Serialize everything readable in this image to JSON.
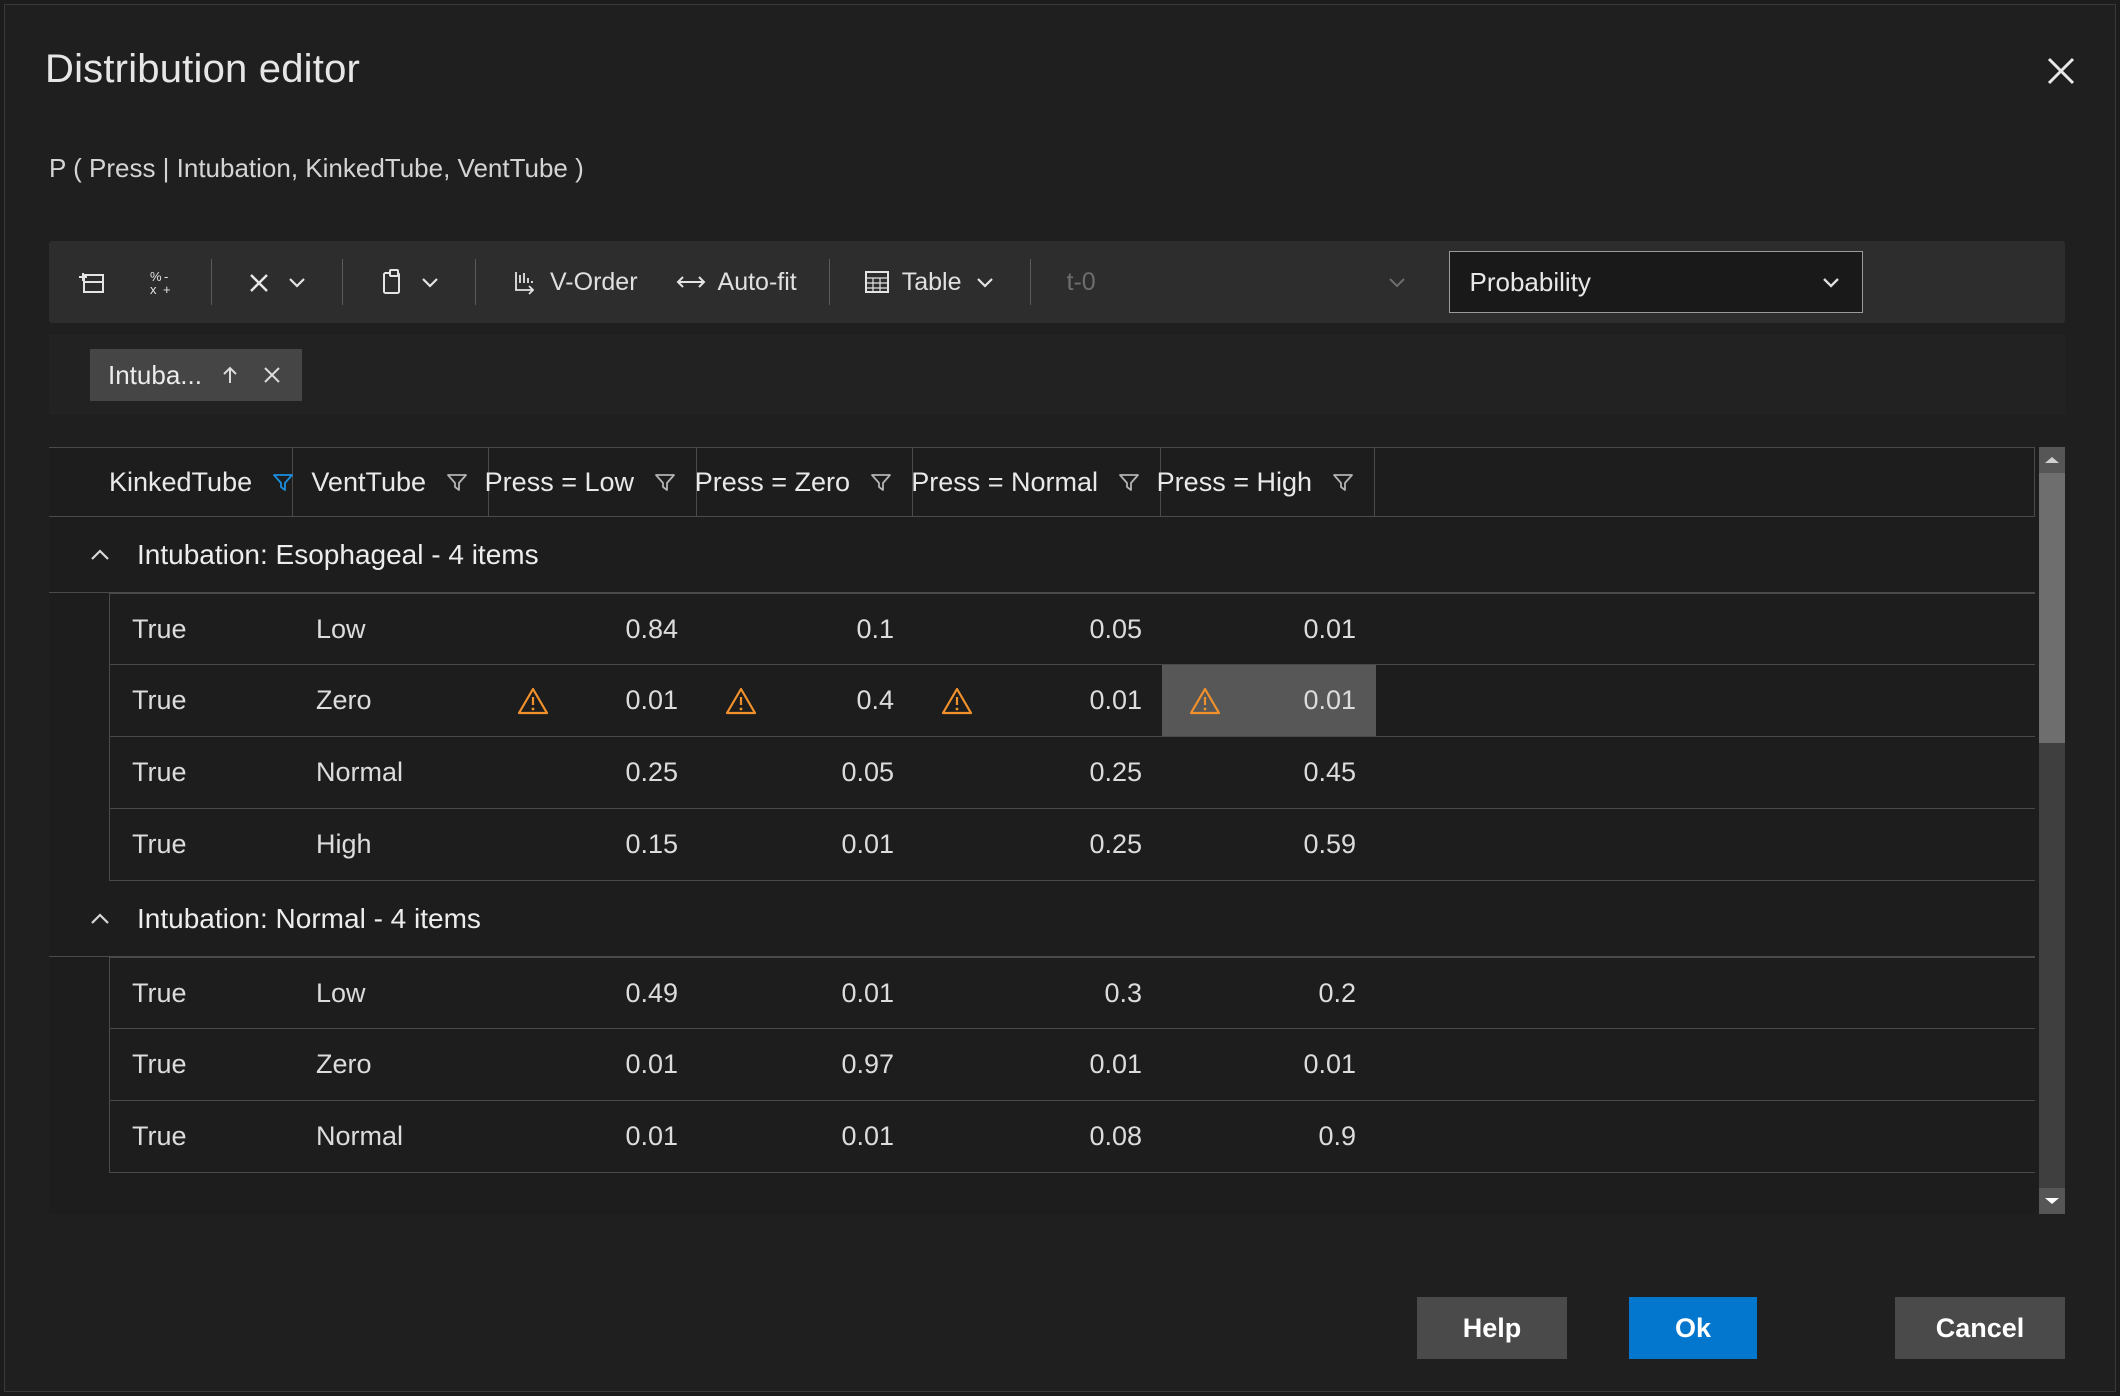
{
  "dialog": {
    "title": "Distribution editor",
    "subtitle": "P ( Press | Intubation, KinkedTube, VentTube )",
    "close_icon": "close-icon"
  },
  "toolbar": {
    "buttons": [
      {
        "name": "add-row-button",
        "icon": "add-table-row-icon",
        "label": ""
      },
      {
        "name": "normalize-button",
        "icon": "percent-variable-icon",
        "label": ""
      },
      {
        "name": "clear-button",
        "icon": "x-icon",
        "label": "",
        "has_chevron": true
      },
      {
        "name": "paste-button",
        "icon": "clipboard-icon",
        "label": "",
        "has_chevron": true
      },
      {
        "name": "v-order-button",
        "icon": "bars-sort-icon",
        "label": "V-Order"
      },
      {
        "name": "auto-fit-button",
        "icon": "arrows-horizontal-icon",
        "label": "Auto-fit"
      },
      {
        "name": "table-view-button",
        "icon": "table-grid-icon",
        "label": "Table",
        "has_chevron": true
      }
    ],
    "time_field": {
      "value": "t-0",
      "chevron_icon": "chevron-down-icon"
    },
    "value_type_select": {
      "value": "Probability",
      "chevron_icon": "chevron-down-icon"
    }
  },
  "chipbar": {
    "chips": [
      {
        "label": "Intuba...",
        "sort_icon": "arrow-up-icon",
        "remove_icon": "close-icon"
      }
    ]
  },
  "grid": {
    "columns": [
      {
        "label": "KinkedTube",
        "filter_icon": "filter-icon",
        "filter_active": true,
        "align": "left"
      },
      {
        "label": "VentTube",
        "filter_icon": "filter-icon",
        "filter_active": false,
        "align": "left"
      },
      {
        "label": "Press = Low",
        "filter_icon": "filter-icon",
        "filter_active": false,
        "align": "right"
      },
      {
        "label": "Press = Zero",
        "filter_icon": "filter-icon",
        "filter_active": false,
        "align": "right"
      },
      {
        "label": "Press = Normal",
        "filter_icon": "filter-icon",
        "filter_active": false,
        "align": "right"
      },
      {
        "label": "Press = High",
        "filter_icon": "filter-icon",
        "filter_active": false,
        "align": "right"
      },
      {
        "label": "",
        "filter_icon": "",
        "filter_active": false,
        "align": "left"
      }
    ],
    "groups": [
      {
        "label": "Intubation: Esophageal - 4 items",
        "collapse_icon": "chevron-up-icon",
        "rows": [
          {
            "kinked": "True",
            "vent": "Low",
            "cells": [
              {
                "value": "0.84",
                "warn": false,
                "selected": false
              },
              {
                "value": "0.1",
                "warn": false,
                "selected": false
              },
              {
                "value": "0.05",
                "warn": false,
                "selected": false
              },
              {
                "value": "0.01",
                "warn": false,
                "selected": false
              }
            ]
          },
          {
            "kinked": "True",
            "vent": "Zero",
            "cells": [
              {
                "value": "0.01",
                "warn": true,
                "selected": false
              },
              {
                "value": "0.4",
                "warn": true,
                "selected": false
              },
              {
                "value": "0.01",
                "warn": true,
                "selected": false
              },
              {
                "value": "0.01",
                "warn": true,
                "selected": true
              }
            ]
          },
          {
            "kinked": "True",
            "vent": "Normal",
            "cells": [
              {
                "value": "0.25",
                "warn": false,
                "selected": false
              },
              {
                "value": "0.05",
                "warn": false,
                "selected": false
              },
              {
                "value": "0.25",
                "warn": false,
                "selected": false
              },
              {
                "value": "0.45",
                "warn": false,
                "selected": false
              }
            ]
          },
          {
            "kinked": "True",
            "vent": "High",
            "cells": [
              {
                "value": "0.15",
                "warn": false,
                "selected": false
              },
              {
                "value": "0.01",
                "warn": false,
                "selected": false
              },
              {
                "value": "0.25",
                "warn": false,
                "selected": false
              },
              {
                "value": "0.59",
                "warn": false,
                "selected": false
              }
            ]
          }
        ]
      },
      {
        "label": "Intubation: Normal - 4 items",
        "collapse_icon": "chevron-up-icon",
        "rows": [
          {
            "kinked": "True",
            "vent": "Low",
            "cells": [
              {
                "value": "0.49",
                "warn": false,
                "selected": false
              },
              {
                "value": "0.01",
                "warn": false,
                "selected": false
              },
              {
                "value": "0.3",
                "warn": false,
                "selected": false
              },
              {
                "value": "0.2",
                "warn": false,
                "selected": false
              }
            ]
          },
          {
            "kinked": "True",
            "vent": "Zero",
            "cells": [
              {
                "value": "0.01",
                "warn": false,
                "selected": false
              },
              {
                "value": "0.97",
                "warn": false,
                "selected": false
              },
              {
                "value": "0.01",
                "warn": false,
                "selected": false
              },
              {
                "value": "0.01",
                "warn": false,
                "selected": false
              }
            ]
          },
          {
            "kinked": "True",
            "vent": "Normal",
            "cells": [
              {
                "value": "0.01",
                "warn": false,
                "selected": false
              },
              {
                "value": "0.01",
                "warn": false,
                "selected": false
              },
              {
                "value": "0.08",
                "warn": false,
                "selected": false
              },
              {
                "value": "0.9",
                "warn": false,
                "selected": false
              }
            ]
          }
        ]
      }
    ],
    "scrollbar": {
      "up_icon": "triangle-up-icon",
      "down_icon": "triangle-down-icon"
    }
  },
  "footer": {
    "help_label": "Help",
    "ok_label": "Ok",
    "cancel_label": "Cancel"
  },
  "colors": {
    "accent": "#0277cd",
    "warning": "#f0912c",
    "filter_active": "#1a8fe0",
    "selection": "#575757"
  }
}
